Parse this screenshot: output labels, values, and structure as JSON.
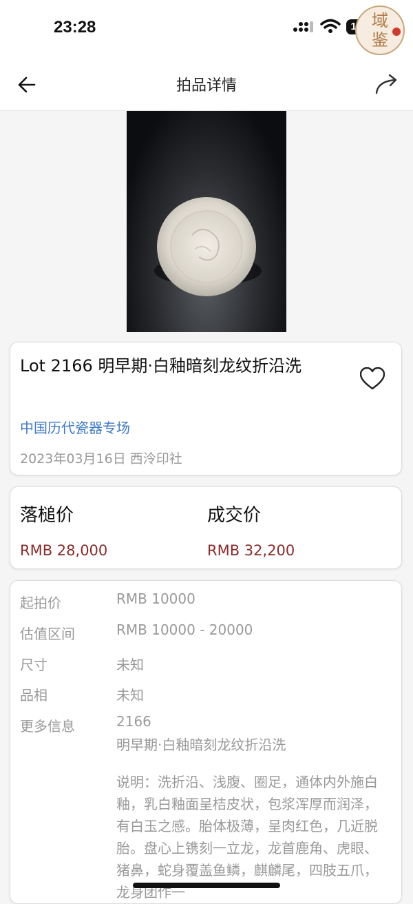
{
  "status_bar": {
    "time": "23:28",
    "battery": "100",
    "seal_text": "域鉴"
  },
  "nav": {
    "title": "拍品详情"
  },
  "lot": {
    "title": "Lot 2166 明早期·白釉暗刻龙纹折沿洗",
    "session": "中国历代瓷器专场",
    "date_house": "2023年03月16日 西泠印社"
  },
  "prices": {
    "hammer_label": "落槌价",
    "hammer_value": "RMB 28,000",
    "deal_label": "成交价",
    "deal_value": "RMB 32,200"
  },
  "details": {
    "rows": [
      {
        "label": "起拍价",
        "value": "RMB 10000"
      },
      {
        "label": "估值区间",
        "value": "RMB 10000 - 20000"
      },
      {
        "label": "尺寸",
        "value": "未知"
      },
      {
        "label": "品相",
        "value": "未知"
      },
      {
        "label": "更多信息",
        "value": "2166"
      }
    ],
    "more_name": "明早期·白釉暗刻龙纹折沿洗",
    "description": "说明：洗折沿、浅腹、圈足，通体内外施白釉，乳白釉面呈桔皮状，包浆浑厚而润泽，有白玉之感。胎体极薄，呈肉红色，几近脱胎。盘心上镌刻一立龙，龙首鹿角、虎眼、猪鼻，蛇身覆盖鱼鳞，麒麟尾，四肢五爪，龙身团作一"
  },
  "colors": {
    "accent_link": "#3c78c8",
    "price_red": "#8c2a2a",
    "muted_text": "#999999"
  }
}
